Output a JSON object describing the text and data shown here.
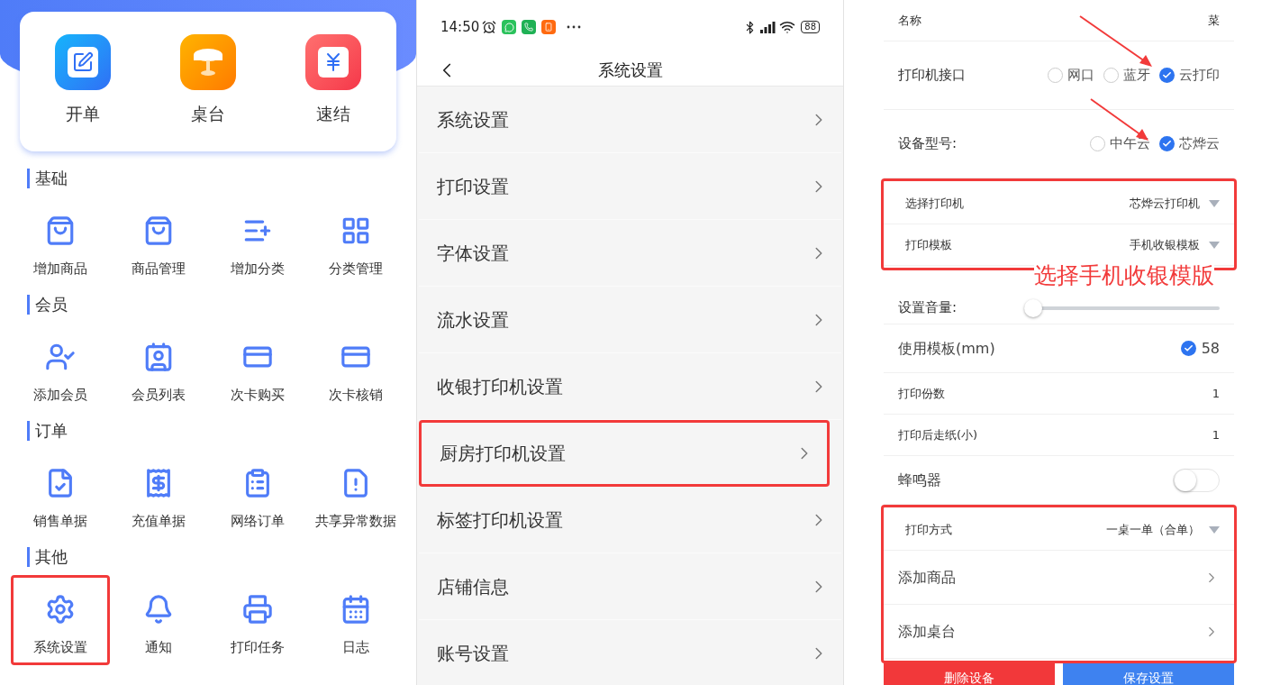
{
  "home": {
    "shortcuts": [
      {
        "label": "开单"
      },
      {
        "label": "桌台"
      },
      {
        "label": "速结"
      }
    ],
    "sections": [
      {
        "title": "基础",
        "items": [
          {
            "label": "增加商品",
            "highlighted": false
          },
          {
            "label": "商品管理",
            "highlighted": false
          },
          {
            "label": "增加分类",
            "highlighted": false
          },
          {
            "label": "分类管理",
            "highlighted": false
          }
        ]
      },
      {
        "title": "会员",
        "items": [
          {
            "label": "添加会员",
            "highlighted": false
          },
          {
            "label": "会员列表",
            "highlighted": false
          },
          {
            "label": "次卡购买",
            "highlighted": false
          },
          {
            "label": "次卡核销",
            "highlighted": false
          }
        ]
      },
      {
        "title": "订单",
        "items": [
          {
            "label": "销售单据",
            "highlighted": false
          },
          {
            "label": "充值单据",
            "highlighted": false
          },
          {
            "label": "网络订单",
            "highlighted": false
          },
          {
            "label": "共享异常数据",
            "highlighted": false
          }
        ]
      },
      {
        "title": "其他",
        "items": [
          {
            "label": "系统设置",
            "highlighted": true
          },
          {
            "label": "通知",
            "highlighted": false
          },
          {
            "label": "打印任务",
            "highlighted": false
          },
          {
            "label": "日志",
            "highlighted": false
          }
        ]
      }
    ]
  },
  "settings_menu": {
    "status_bar": {
      "time": "14:50",
      "battery": "88"
    },
    "title": "系统设置",
    "items": [
      {
        "label": "系统设置",
        "highlighted": false
      },
      {
        "label": "打印设置",
        "highlighted": false
      },
      {
        "label": "字体设置",
        "highlighted": false
      },
      {
        "label": "流水设置",
        "highlighted": false
      },
      {
        "label": "收银打印机设置",
        "highlighted": false
      },
      {
        "label": "厨房打印机设置",
        "highlighted": true
      },
      {
        "label": "标签打印机设置",
        "highlighted": false
      },
      {
        "label": "店铺信息",
        "highlighted": false
      },
      {
        "label": "账号设置",
        "highlighted": false
      }
    ]
  },
  "printer_form": {
    "annotation": "选择手机收银模版",
    "sections": [
      {
        "highlighted": false,
        "rows": [
          {
            "kind": "value",
            "label": "名称",
            "value": "菜"
          },
          {
            "kind": "radio",
            "label": "打印机接口",
            "options": [
              {
                "label": "网口",
                "selected": false
              },
              {
                "label": "蓝牙",
                "selected": false
              },
              {
                "label": "云打印",
                "selected": true
              }
            ]
          },
          {
            "kind": "radio",
            "label": "设备型号:",
            "options": [
              {
                "label": "中午云",
                "selected": false
              },
              {
                "label": "芯烨云",
                "selected": true
              }
            ]
          }
        ]
      },
      {
        "highlighted": true,
        "rows": [
          {
            "kind": "select",
            "label": "选择打印机",
            "value": "芯烨云打印机"
          },
          {
            "kind": "select",
            "label": "打印模板",
            "value": "手机收银模板"
          }
        ]
      },
      {
        "highlighted": false,
        "rows": [
          {
            "kind": "slider",
            "label": "设置音量:",
            "level": 0
          },
          {
            "kind": "check",
            "label": "使用模板(mm)",
            "checked": true,
            "value": "58"
          },
          {
            "kind": "value",
            "label": "打印份数",
            "value": "1"
          },
          {
            "kind": "value",
            "label": "打印后走纸(小)",
            "value": "1"
          },
          {
            "kind": "toggle",
            "label": "蜂鸣器",
            "on": false
          }
        ]
      },
      {
        "highlighted": true,
        "rows": [
          {
            "kind": "select",
            "label": "打印方式",
            "value": "一桌一单（合单）"
          },
          {
            "kind": "link",
            "label": "添加商品"
          },
          {
            "kind": "link",
            "label": "添加桌台"
          }
        ]
      }
    ],
    "buttons": [
      {
        "label": "删除设备",
        "kind": "danger"
      },
      {
        "label": "保存设置",
        "kind": "primary"
      }
    ]
  }
}
